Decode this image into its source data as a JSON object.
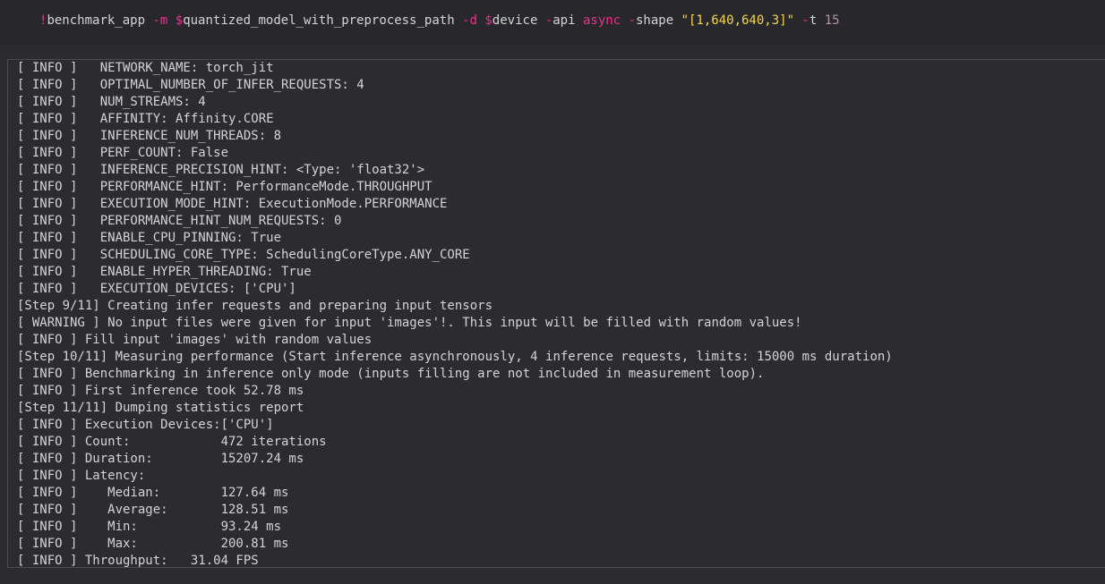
{
  "input_cell": {
    "tokens": [
      {
        "cls": "tok-bang",
        "text": "!"
      },
      {
        "cls": "tok-cmd",
        "text": "benchmark_app "
      },
      {
        "cls": "tok-flag",
        "text": "-m "
      },
      {
        "cls": "tok-var",
        "text": "$"
      },
      {
        "cls": "tok-plain",
        "text": "quantized_model_with_preprocess_path "
      },
      {
        "cls": "tok-flag",
        "text": "-d "
      },
      {
        "cls": "tok-var",
        "text": "$"
      },
      {
        "cls": "tok-plain",
        "text": "device "
      },
      {
        "cls": "tok-flag",
        "text": "-"
      },
      {
        "cls": "tok-plain",
        "text": "api "
      },
      {
        "cls": "tok-kw",
        "text": "async "
      },
      {
        "cls": "tok-flag",
        "text": "-"
      },
      {
        "cls": "tok-plain",
        "text": "shape "
      },
      {
        "cls": "tok-str",
        "text": "\"[1,640,640,3]\" "
      },
      {
        "cls": "tok-flag",
        "text": "-"
      },
      {
        "cls": "tok-plain",
        "text": "t "
      },
      {
        "cls": "tok-num",
        "text": "15"
      }
    ]
  },
  "output_cell": {
    "lines": [
      "[ INFO ]   NETWORK_NAME: torch_jit",
      "[ INFO ]   OPTIMAL_NUMBER_OF_INFER_REQUESTS: 4",
      "[ INFO ]   NUM_STREAMS: 4",
      "[ INFO ]   AFFINITY: Affinity.CORE",
      "[ INFO ]   INFERENCE_NUM_THREADS: 8",
      "[ INFO ]   PERF_COUNT: False",
      "[ INFO ]   INFERENCE_PRECISION_HINT: <Type: 'float32'>",
      "[ INFO ]   PERFORMANCE_HINT: PerformanceMode.THROUGHPUT",
      "[ INFO ]   EXECUTION_MODE_HINT: ExecutionMode.PERFORMANCE",
      "[ INFO ]   PERFORMANCE_HINT_NUM_REQUESTS: 0",
      "[ INFO ]   ENABLE_CPU_PINNING: True",
      "[ INFO ]   SCHEDULING_CORE_TYPE: SchedulingCoreType.ANY_CORE",
      "[ INFO ]   ENABLE_HYPER_THREADING: True",
      "[ INFO ]   EXECUTION_DEVICES: ['CPU']",
      "[Step 9/11] Creating infer requests and preparing input tensors",
      "[ WARNING ] No input files were given for input 'images'!. This input will be filled with random values!",
      "[ INFO ] Fill input 'images' with random values",
      "[Step 10/11] Measuring performance (Start inference asynchronously, 4 inference requests, limits: 15000 ms duration)",
      "[ INFO ] Benchmarking in inference only mode (inputs filling are not included in measurement loop).",
      "[ INFO ] First inference took 52.78 ms",
      "[Step 11/11] Dumping statistics report",
      "[ INFO ] Execution Devices:['CPU']",
      "[ INFO ] Count:            472 iterations",
      "[ INFO ] Duration:         15207.24 ms",
      "[ INFO ] Latency:",
      "[ INFO ]    Median:        127.64 ms",
      "[ INFO ]    Average:       128.51 ms",
      "[ INFO ]    Min:           93.24 ms",
      "[ INFO ]    Max:           200.81 ms",
      "[ INFO ] Throughput:   31.04 FPS"
    ]
  }
}
